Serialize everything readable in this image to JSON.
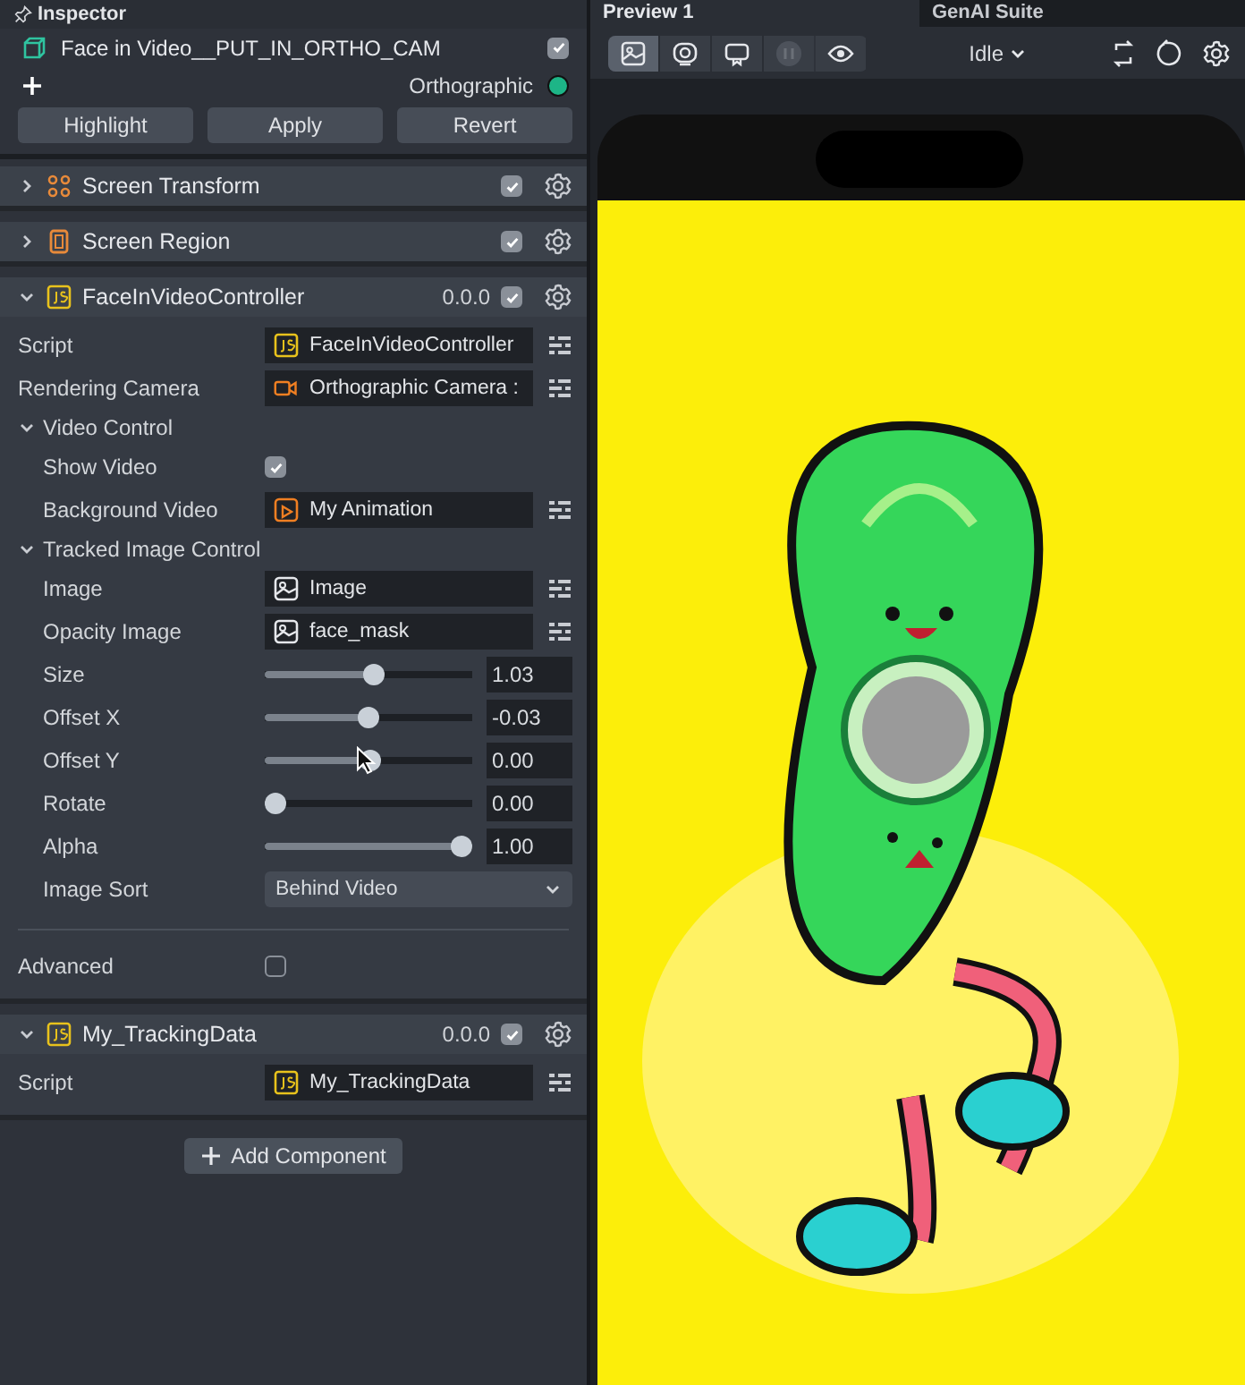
{
  "inspector": {
    "title": "Inspector",
    "object": {
      "name": "Face in Video__PUT_IN_ORTHO_CAM",
      "enabled": true
    },
    "camera": {
      "label": "Orthographic",
      "color": "#1db587"
    },
    "buttons": [
      "Highlight",
      "Apply",
      "Revert"
    ]
  },
  "components": [
    {
      "name": "Screen Transform",
      "kind": "transform",
      "expanded": false,
      "enabled": true
    },
    {
      "name": "Screen Region",
      "kind": "region",
      "expanded": false,
      "enabled": true
    },
    {
      "name": "FaceInVideoController",
      "kind": "script",
      "version": "0.0.0",
      "expanded": true,
      "enabled": true,
      "rows": [
        {
          "kind": "script",
          "label": "Script",
          "value": "FaceInVideoController"
        },
        {
          "kind": "camera",
          "label": "Rendering Camera",
          "value": "Orthographic Camera :"
        },
        {
          "kind": "group",
          "label": "Video Control",
          "expanded": true,
          "children": [
            {
              "kind": "checkbox",
              "label": "Show Video",
              "checked": true
            },
            {
              "kind": "video",
              "label": "Background Video",
              "value": "My Animation"
            }
          ]
        },
        {
          "kind": "group",
          "label": "Tracked Image Control",
          "expanded": true,
          "children": [
            {
              "kind": "image",
              "label": "Image",
              "value": "Image"
            },
            {
              "kind": "image",
              "label": "Opacity Image",
              "value": "face_mask"
            },
            {
              "kind": "slider",
              "label": "Size",
              "level": 0.53,
              "reading": "1.03"
            },
            {
              "kind": "slider",
              "label": "Offset X",
              "level": 0.5,
              "reading": "-0.03"
            },
            {
              "kind": "slider",
              "label": "Offset Y",
              "level": 0.51,
              "reading": "0.00"
            },
            {
              "kind": "slider",
              "label": "Rotate",
              "level": 0,
              "reading": "0.00"
            },
            {
              "kind": "slider",
              "label": "Alpha",
              "level": 1,
              "reading": "1.00"
            },
            {
              "kind": "dropdown",
              "label": "Image Sort",
              "value": "Behind Video"
            }
          ]
        },
        {
          "kind": "checkbox",
          "label": "Advanced",
          "checked": false
        }
      ]
    },
    {
      "name": "My_TrackingData",
      "kind": "script",
      "version": "0.0.0",
      "expanded": true,
      "enabled": true,
      "rows": [
        {
          "kind": "script",
          "label": "Script",
          "value": "My_TrackingData"
        }
      ]
    }
  ],
  "add_component": "Add Component",
  "preview": {
    "tabs": [
      {
        "label": "Preview 1",
        "selected": true
      },
      {
        "label": "GenAI Suite",
        "selected": false
      }
    ],
    "modes": [
      {
        "kind": "image",
        "selected": true,
        "disabled": false
      },
      {
        "kind": "record",
        "selected": false,
        "disabled": false
      },
      {
        "kind": "device",
        "selected": false,
        "disabled": false
      },
      {
        "kind": "pause",
        "selected": false,
        "disabled": true
      },
      {
        "kind": "eye",
        "selected": false,
        "disabled": false
      }
    ],
    "state": "Idle"
  }
}
